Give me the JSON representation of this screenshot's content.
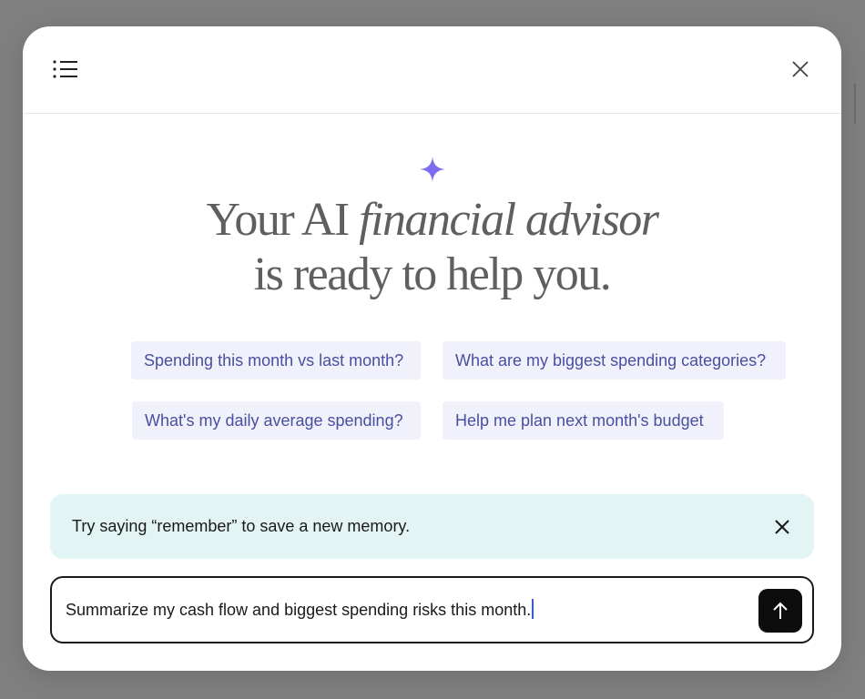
{
  "headline": {
    "line1_plain": "Your AI",
    "line1_italic": "financial advisor",
    "line2": "is ready to help you."
  },
  "suggestions": [
    {
      "label": "Spending this month vs last month?"
    },
    {
      "label": "What are my biggest spending categories?"
    },
    {
      "label": "What's my daily average spending?"
    },
    {
      "label": "Help me plan next month's budget"
    }
  ],
  "tip": {
    "text": "Try saying “remember” to save a new memory."
  },
  "input": {
    "value": "Summarize my cash flow and biggest spending risks this month."
  },
  "icons": {
    "menu": "list-menu-icon",
    "close": "close-icon",
    "sparkle": "sparkle-icon",
    "send": "arrow-up-icon"
  },
  "colors": {
    "accent": "#7b6cf0",
    "suggestion_bg": "#f0f1fb",
    "suggestion_text": "#4a4fa0",
    "tip_bg": "#e2f4f3",
    "send_bg": "#0d0d0d"
  }
}
